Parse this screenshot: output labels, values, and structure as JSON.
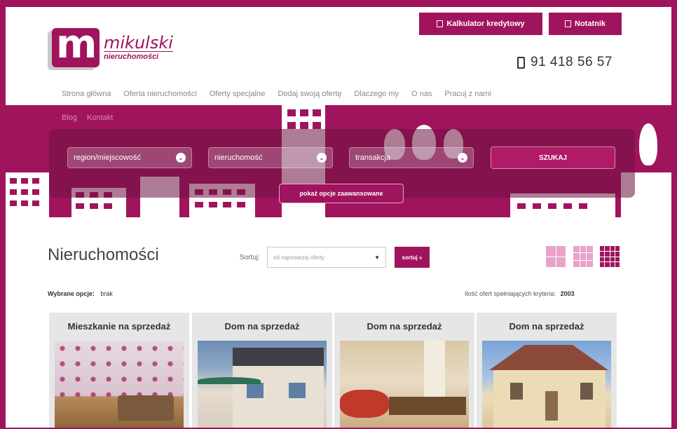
{
  "header": {
    "logo_name": "mikulski",
    "logo_sub": "nieruchomości",
    "calc_button": "Kalkulator kredytowy",
    "notes_button": "Notatnik",
    "phone": "91 418 56 57"
  },
  "nav": {
    "items": [
      "Strona główna",
      "Oferta nieruchomości",
      "Oferty specjalne",
      "Dodaj swoją ofertę",
      "Dlaczego my",
      "O nas",
      "Pracuj z nami"
    ],
    "items2": [
      "Blog",
      "Kontakt"
    ]
  },
  "search": {
    "region": "region/miejscowość",
    "property": "nieruchomość",
    "transaction": "transakcja",
    "search_button": "SZUKAJ",
    "advanced_button": "pokaż opcje zaawansowane"
  },
  "listing": {
    "title": "Nieruchomości",
    "sort_label": "Sortuj:",
    "sort_value": "od najnowszej oferty",
    "sort_button": "sortuj »",
    "selected_label": "Wybrane opcje:",
    "selected_value": "brak",
    "count_label": "Ilość ofert spełniających kryteria:",
    "count_value": "2003"
  },
  "cards": [
    {
      "title": "Mieszkanie na sprzedaż"
    },
    {
      "title": "Dom na sprzedaż"
    },
    {
      "title": "Dom na sprzedaż"
    },
    {
      "title": "Dom na sprzedaż"
    }
  ],
  "colors": {
    "brand": "#a0145e",
    "brand_light": "#e9a3c9",
    "card_bg": "#e6e6e6"
  }
}
